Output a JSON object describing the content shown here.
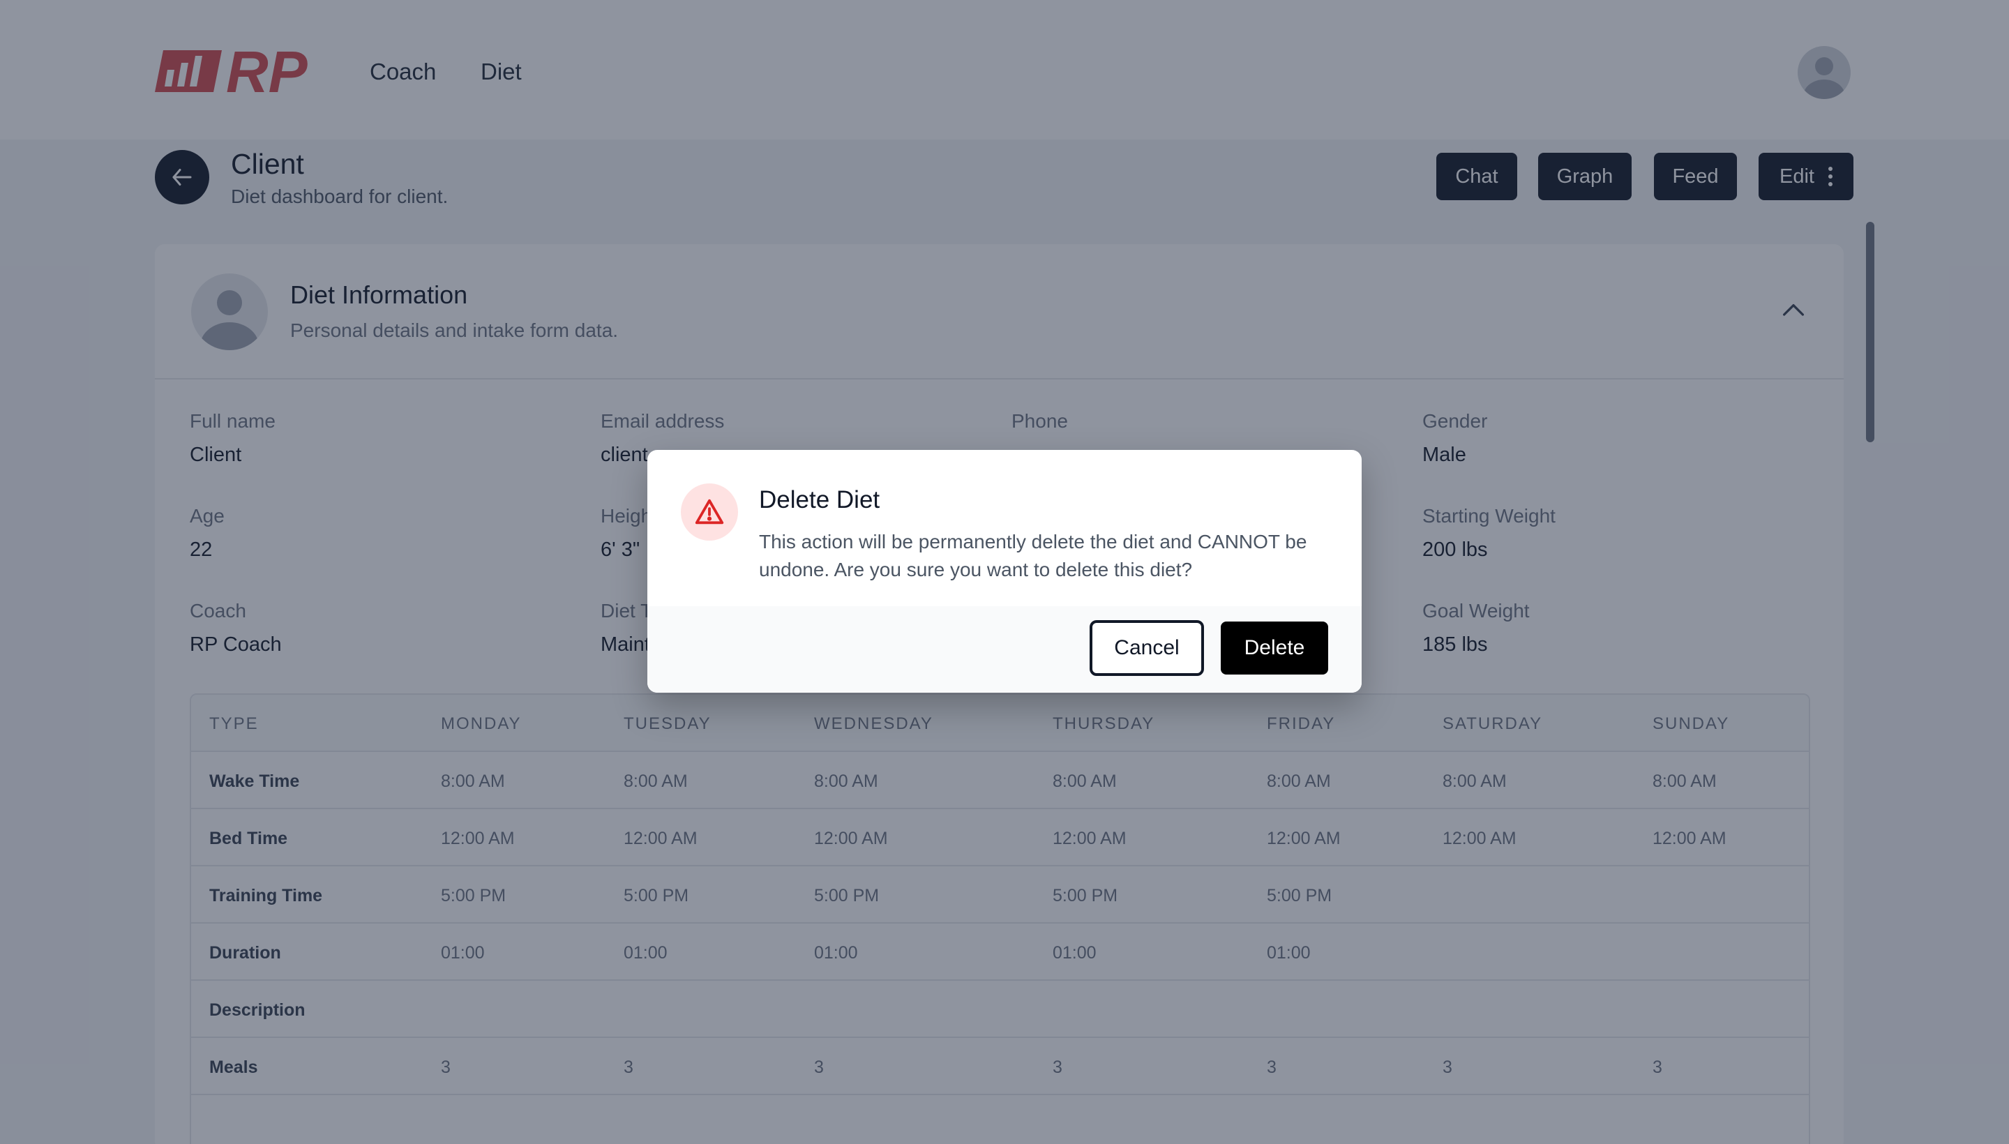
{
  "colors": {
    "brand": "#d14b4f",
    "primary_button": "#111827",
    "danger_icon": "#dc2626",
    "danger_icon_bg": "#fee2e2",
    "overlay": "rgba(31,41,64,0.5)"
  },
  "nav": {
    "logo_text": "RP",
    "items": [
      "Coach",
      "Diet"
    ],
    "user_avatar_icon": "user-avatar-icon"
  },
  "header": {
    "title": "Client",
    "subtitle": "Diet dashboard for client.",
    "back_icon": "arrow-left-icon",
    "buttons": {
      "chat": "Chat",
      "graph": "Graph",
      "feed": "Feed",
      "edit": "Edit"
    }
  },
  "diet_info": {
    "title": "Diet Information",
    "subtitle": "Personal details and intake form data.",
    "collapse_icon": "chevron-up-icon",
    "fields": {
      "full_name": {
        "label": "Full name",
        "value": "Client"
      },
      "email": {
        "label": "Email address",
        "value": "client"
      },
      "phone": {
        "label": "Phone",
        "value": ""
      },
      "gender": {
        "label": "Gender",
        "value": "Male"
      },
      "age": {
        "label": "Age",
        "value": "22"
      },
      "height": {
        "label": "Heigh",
        "value": "6' 3\""
      },
      "starting_weight": {
        "label": "Starting Weight",
        "value": "200 lbs"
      },
      "coach": {
        "label": "Coach",
        "value": "RP Coach"
      },
      "diet_type": {
        "label": "Diet T",
        "value": "Maint"
      },
      "goal_weight": {
        "label": "Goal Weight",
        "value": "185 lbs"
      }
    }
  },
  "schedule": {
    "headers": [
      "TYPE",
      "MONDAY",
      "TUESDAY",
      "WEDNESDAY",
      "THURSDAY",
      "FRIDAY",
      "SATURDAY",
      "SUNDAY"
    ],
    "rows": [
      {
        "type": "Wake Time",
        "cells": [
          "8:00 AM",
          "8:00 AM",
          "8:00 AM",
          "8:00 AM",
          "8:00 AM",
          "8:00 AM",
          "8:00 AM"
        ]
      },
      {
        "type": "Bed Time",
        "cells": [
          "12:00 AM",
          "12:00 AM",
          "12:00 AM",
          "12:00 AM",
          "12:00 AM",
          "12:00 AM",
          "12:00 AM"
        ]
      },
      {
        "type": "Training Time",
        "cells": [
          "5:00 PM",
          "5:00 PM",
          "5:00 PM",
          "5:00 PM",
          "5:00 PM",
          "",
          ""
        ]
      },
      {
        "type": "Duration",
        "cells": [
          "01:00",
          "01:00",
          "01:00",
          "01:00",
          "01:00",
          "",
          ""
        ]
      },
      {
        "type": "Description",
        "cells": [
          "",
          "",
          "",
          "",
          "",
          "",
          ""
        ]
      },
      {
        "type": "Meals",
        "cells": [
          "3",
          "3",
          "3",
          "3",
          "3",
          "3",
          "3"
        ]
      }
    ]
  },
  "modal": {
    "icon": "warning-triangle-icon",
    "title": "Delete Diet",
    "body": "This action will be permanently delete the diet and CANNOT be undone. Are you sure you want to delete this diet?",
    "cancel_label": "Cancel",
    "delete_label": "Delete"
  }
}
